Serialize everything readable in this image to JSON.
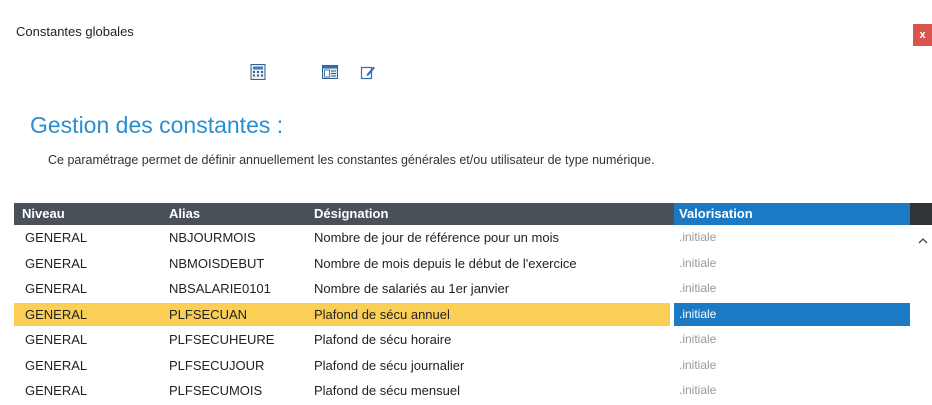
{
  "window": {
    "title": "Constantes globales",
    "close_label": "x"
  },
  "toolbar": {
    "icons": [
      "calculator-icon",
      "window-list-icon",
      "edit-icon"
    ]
  },
  "heading": "Gestion des constantes :",
  "description": "Ce paramétrage permet de définir annuellement les constantes générales et/ou utilisateur de type numérique.",
  "grid": {
    "columns": [
      "Niveau",
      "Alias",
      "Désignation",
      "Valorisation"
    ],
    "rows": [
      {
        "niveau": "GENERAL",
        "alias": "NBJOURMOIS",
        "designation": "Nombre de jour de référence pour un mois",
        "valorisation": ".initiale"
      },
      {
        "niveau": "GENERAL",
        "alias": "NBMOISDEBUT",
        "designation": "Nombre de mois depuis le début de l'exercice",
        "valorisation": ".initiale"
      },
      {
        "niveau": "GENERAL",
        "alias": "NBSALARIE0101",
        "designation": "Nombre de salariés au 1er janvier",
        "valorisation": ".initiale"
      },
      {
        "niveau": "GENERAL",
        "alias": "PLFSECUAN",
        "designation": "Plafond de sécu annuel",
        "valorisation": ".initiale"
      },
      {
        "niveau": "GENERAL",
        "alias": "PLFSECUHEURE",
        "designation": "Plafond de sécu horaire",
        "valorisation": ".initiale"
      },
      {
        "niveau": "GENERAL",
        "alias": "PLFSECUJOUR",
        "designation": "Plafond de sécu journalier",
        "valorisation": ".initiale"
      },
      {
        "niveau": "GENERAL",
        "alias": "PLFSECUMOIS",
        "designation": "Plafond de sécu mensuel",
        "valorisation": ".initiale"
      }
    ],
    "selected_row_index": 3
  },
  "colors": {
    "heading": "#2a8fd0",
    "header_bg": "#4a5058",
    "selection_yellow": "#fbcf55",
    "selection_blue": "#1c7ac4",
    "close_red": "#d9534f"
  }
}
